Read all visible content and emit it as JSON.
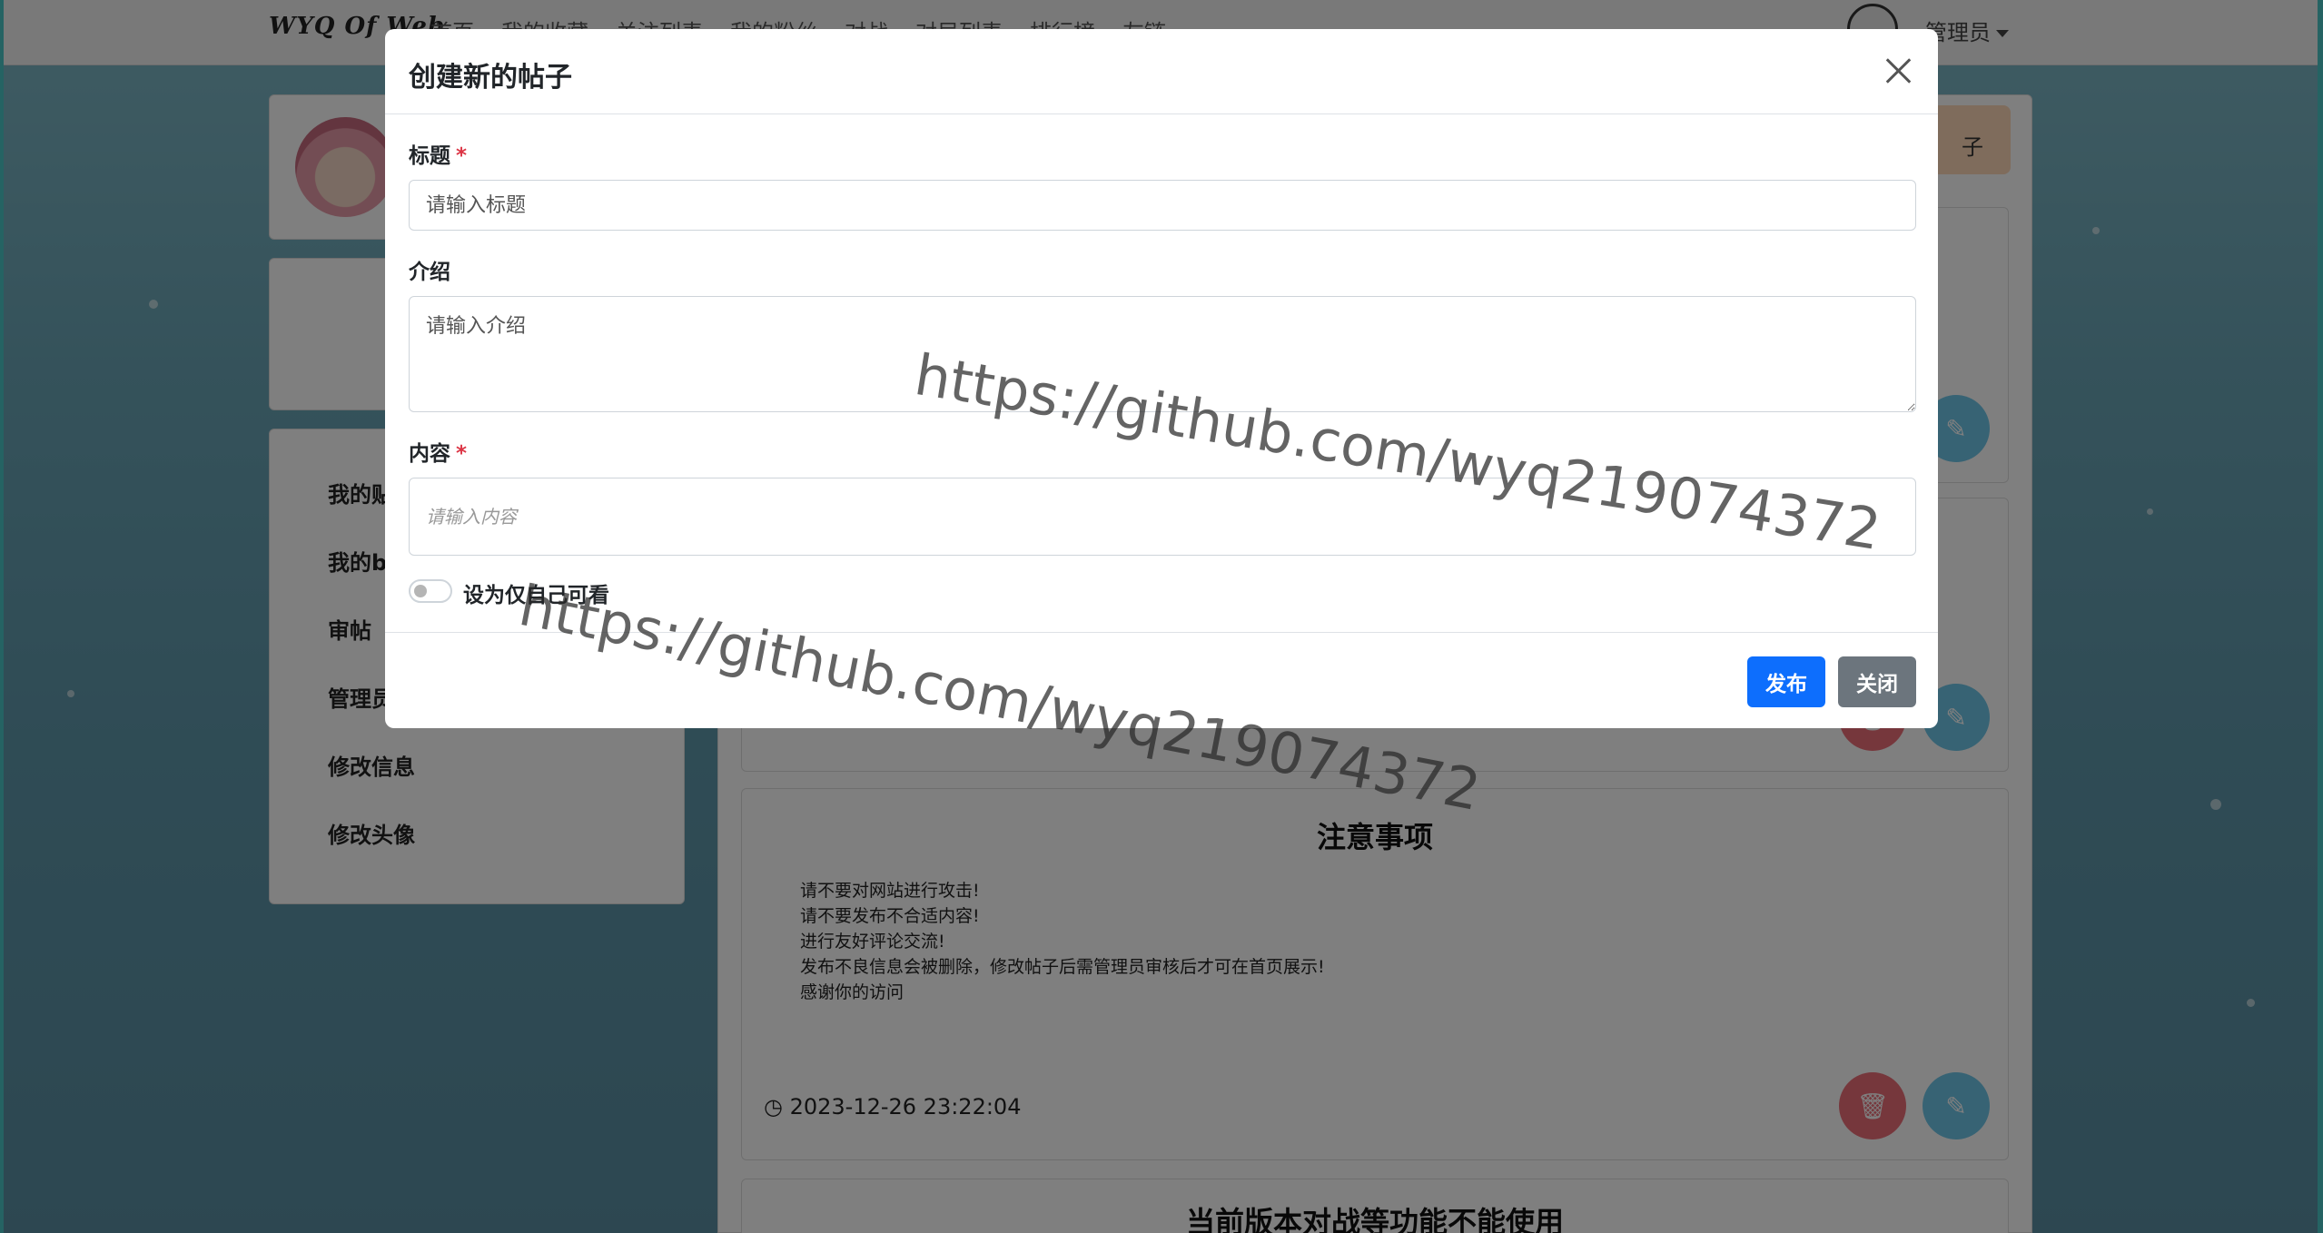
{
  "navbar": {
    "brand": "WYQ Of Web",
    "links": [
      "首页",
      "我的收藏",
      "关注列表",
      "我的粉丝",
      "对战",
      "对局列表",
      "排行榜",
      "友链"
    ],
    "user": "管理员"
  },
  "sidebar": {
    "items": [
      {
        "label": "我的贴"
      },
      {
        "label": "我的b"
      },
      {
        "label": "审帖"
      },
      {
        "label": "管理员"
      },
      {
        "label": "修改信息"
      },
      {
        "label": "修改头像"
      }
    ]
  },
  "main": {
    "new_post_button": "子",
    "notice": {
      "title": "注意事项",
      "lines": [
        "请不要对网站进行攻击!",
        "请不要发布不合适内容!",
        "进行友好评论交流!",
        "发布不良信息会被删除，修改帖子后需管理员审核后才可在首页展示!",
        "感谢你的访问"
      ],
      "time": "2023-12-26 23:22:04"
    },
    "next_post_title": "当前版本对战等功能不能使用"
  },
  "modal": {
    "title": "创建新的帖子",
    "title_label": "标题",
    "title_placeholder": "请输入标题",
    "intro_label": "介绍",
    "intro_placeholder": "请输入介绍",
    "content_label": "内容",
    "content_placeholder": "请输入内容",
    "required_mark": "*",
    "private_toggle_label": "设为仅自己可看",
    "publish_button": "发布",
    "close_button": "关闭"
  },
  "watermark": {
    "text": "https://github.com/wyq219074372"
  },
  "colors": {
    "primary": "#0d6efd",
    "secondary": "#6c757d",
    "danger": "#dc3545",
    "delete_button": "#ed6e78",
    "edit_button": "#6fc6e8"
  }
}
